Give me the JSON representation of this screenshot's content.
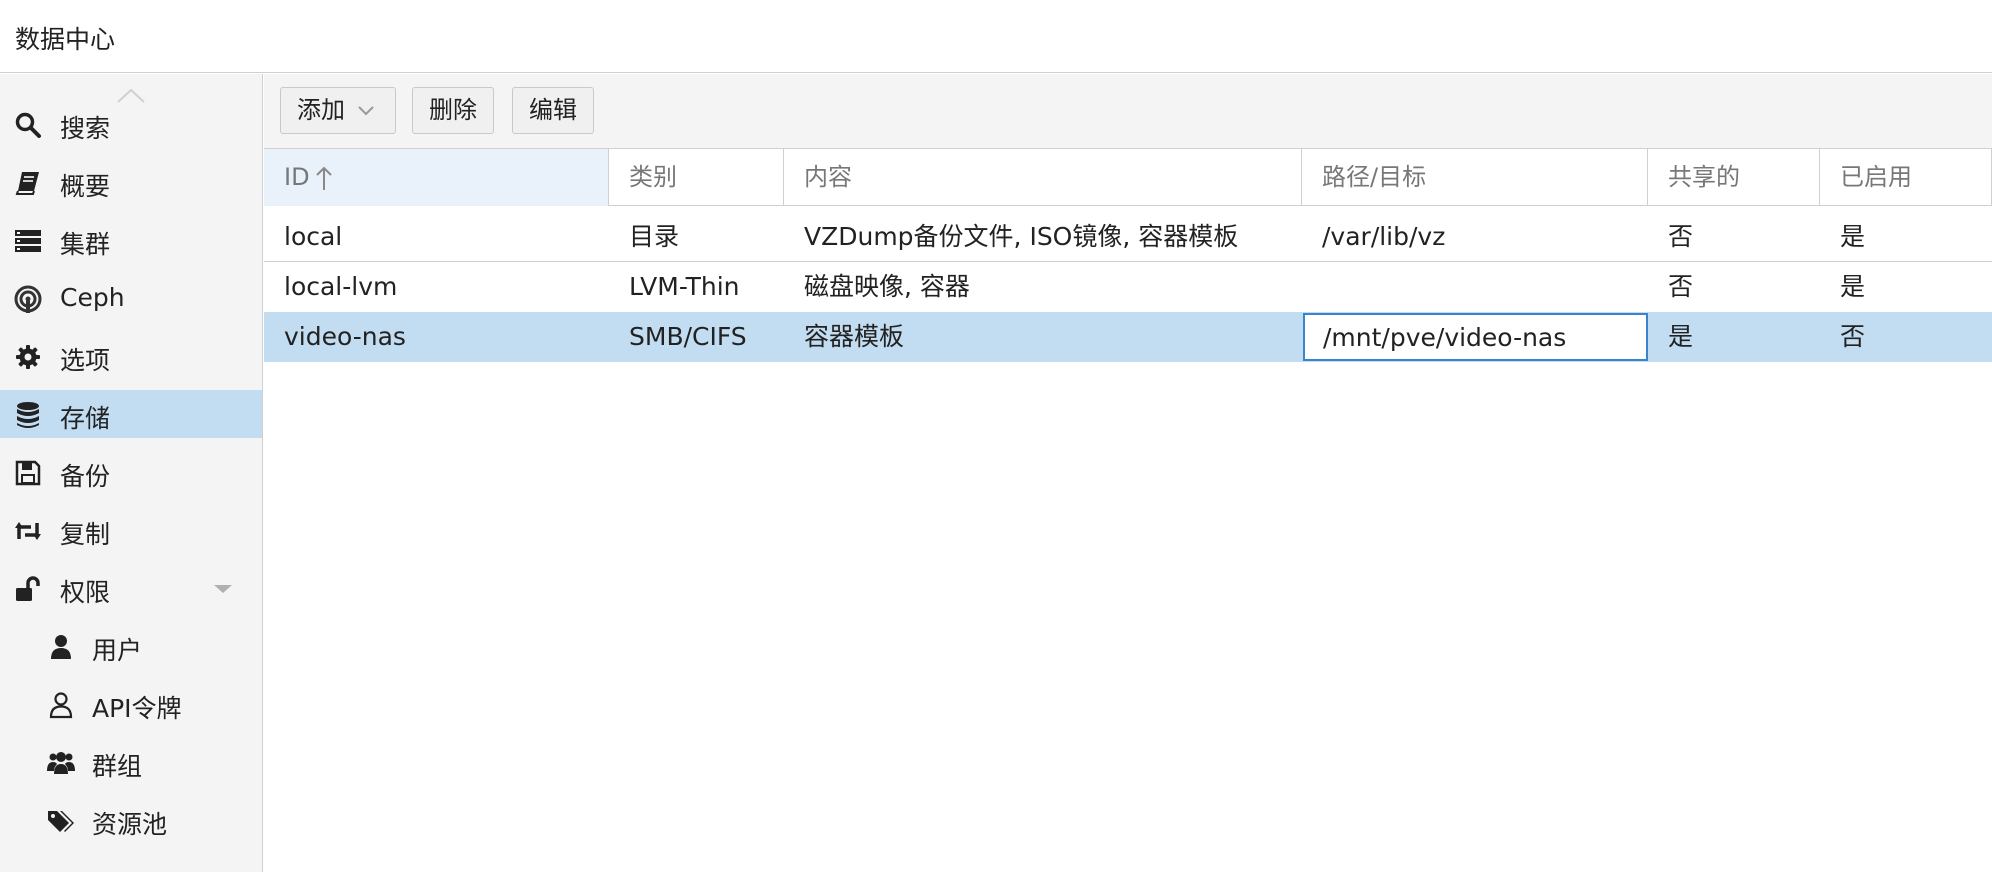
{
  "header": {
    "title": "数据中心"
  },
  "sidebar": {
    "items": [
      {
        "label": "搜索",
        "icon": "search-icon"
      },
      {
        "label": "概要",
        "icon": "book-icon"
      },
      {
        "label": "集群",
        "icon": "server-icon"
      },
      {
        "label": "Ceph",
        "icon": "ceph-icon"
      },
      {
        "label": "选项",
        "icon": "gear-icon"
      },
      {
        "label": "存储",
        "icon": "database-icon",
        "selected": true
      },
      {
        "label": "备份",
        "icon": "floppy-icon"
      },
      {
        "label": "复制",
        "icon": "retweet-icon"
      },
      {
        "label": "权限",
        "icon": "unlock-icon",
        "expanded": true
      },
      {
        "label": "用户",
        "icon": "user-icon"
      },
      {
        "label": "API令牌",
        "icon": "user-outline-icon"
      },
      {
        "label": "群组",
        "icon": "users-icon"
      },
      {
        "label": "资源池",
        "icon": "tags-icon"
      }
    ]
  },
  "toolbar": {
    "add_label": "添加",
    "delete_label": "删除",
    "edit_label": "编辑"
  },
  "grid": {
    "columns": [
      "ID",
      "类别",
      "内容",
      "路径/目标",
      "共享的",
      "已启用"
    ],
    "sorted_column": "ID",
    "sort_direction": "ascending",
    "rows": [
      {
        "id": "local",
        "type": "目录",
        "content": "VZDump备份文件, ISO镜像, 容器模板",
        "path": "/var/lib/vz",
        "shared": "否",
        "enabled": "是"
      },
      {
        "id": "local-lvm",
        "type": "LVM-Thin",
        "content": "磁盘映像, 容器",
        "path": "",
        "shared": "否",
        "enabled": "是"
      },
      {
        "id": "video-nas",
        "type": "SMB/CIFS",
        "content": "容器模板",
        "path": "/mnt/pve/video-nas",
        "shared": "是",
        "enabled": "否",
        "selected": true
      }
    ]
  },
  "colors": {
    "selection": "#c2ddf2",
    "focus_border": "#3a84cc",
    "sort_header": "#e9f2fb"
  }
}
